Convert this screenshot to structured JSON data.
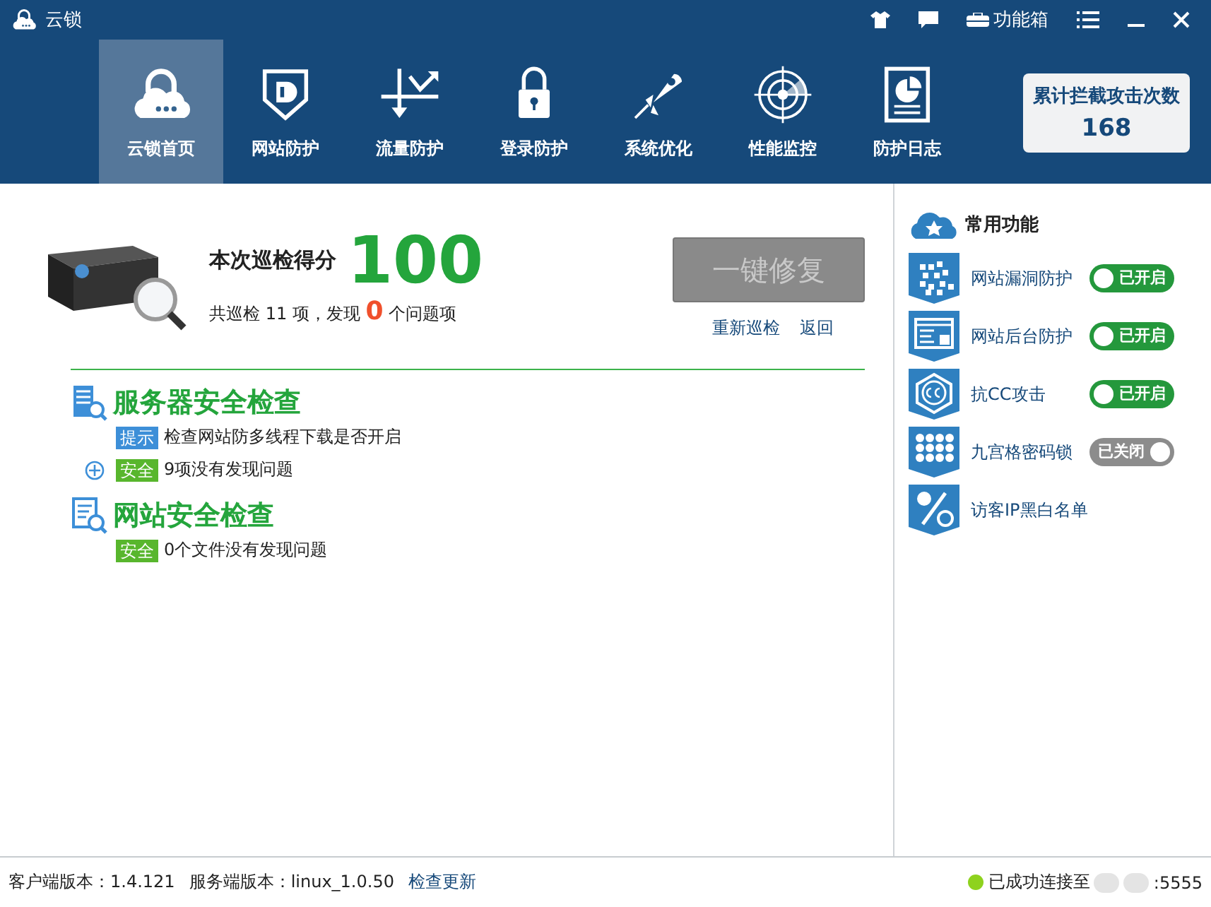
{
  "window": {
    "title": "云锁",
    "toolbox_label": "功能箱"
  },
  "nav": [
    {
      "label": "云锁首页",
      "selected": true
    },
    {
      "label": "网站防护",
      "selected": false
    },
    {
      "label": "流量防护",
      "selected": false
    },
    {
      "label": "登录防护",
      "selected": false
    },
    {
      "label": "系统优化",
      "selected": false
    },
    {
      "label": "性能监控",
      "selected": false
    },
    {
      "label": "防护日志",
      "selected": false
    }
  ],
  "counter": {
    "label": "累计拦截攻击次数",
    "value": "168"
  },
  "scan": {
    "score_label": "本次巡检得分",
    "score": "100",
    "summary_before": "共巡检 11 项，发现",
    "issues": "0",
    "summary_after": "个问题项",
    "repair_button": {
      "label": "一键修复",
      "disabled": true
    },
    "links": [
      "重新巡检",
      "返回"
    ]
  },
  "sections": [
    {
      "title": "服务器安全检查",
      "items": [
        {
          "tag": "提示",
          "kind": "tip",
          "text": "检查网站防多线程下载是否开启",
          "expandable": false
        },
        {
          "tag": "安全",
          "kind": "safe",
          "text": "9项没有发现问题",
          "expandable": true
        }
      ]
    },
    {
      "title": "网站安全检查",
      "items": [
        {
          "tag": "安全",
          "kind": "safe",
          "text": "0个文件没有发现问题",
          "expandable": false
        }
      ]
    }
  ],
  "features_panel": {
    "title": "常用功能",
    "items": [
      {
        "label": "网站漏洞防护",
        "toggle": {
          "on": true,
          "label": "已开启"
        }
      },
      {
        "label": "网站后台防护",
        "toggle": {
          "on": true,
          "label": "已开启"
        }
      },
      {
        "label": "抗CC攻击",
        "toggle": {
          "on": true,
          "label": "已开启"
        }
      },
      {
        "label": "九宫格密码锁",
        "toggle": {
          "on": false,
          "label": "已关闭"
        }
      },
      {
        "label": "访客IP黑白名单"
      }
    ]
  },
  "status_bar": {
    "client_version": "客户端版本：1.4.121",
    "server_version": "服务端版本：linux_1.0.50",
    "update_link": "检查更新",
    "connection": "已成功连接至",
    "port": ":5555"
  }
}
